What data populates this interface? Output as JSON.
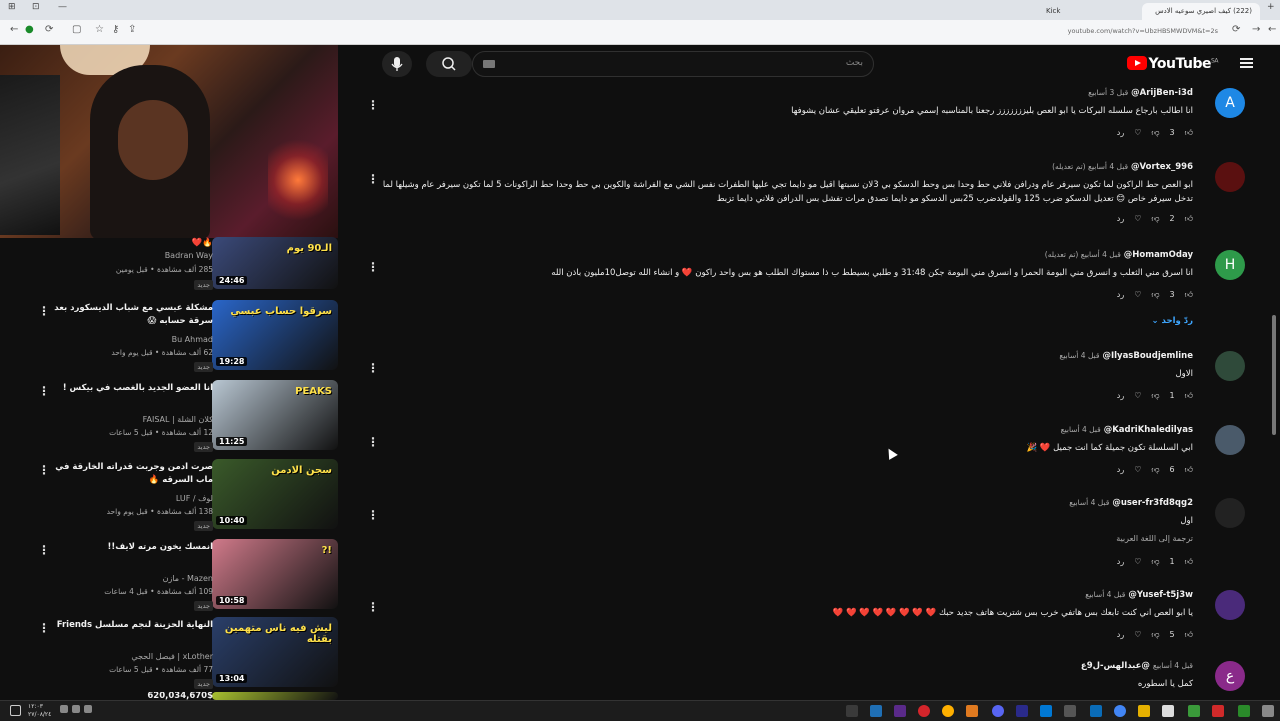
{
  "browser": {
    "tabs": [
      {
        "label": "(222) كيف اصيري سوعيه الادس",
        "active": true
      },
      {
        "label": "Kick",
        "active": false
      }
    ],
    "url": "youtube.com/watch?v=UbzHBSMWDVM&t=2s"
  },
  "youtube": {
    "logo": "YouTube",
    "region": "SA",
    "search_placeholder": "بحث"
  },
  "sidebar": {
    "videos": [
      {
        "title": "🔥❤️",
        "channel": "Badran Way",
        "meta": "285 ألف مشاهدة • قبل يومين",
        "badge": "جديد",
        "duration": "24:46",
        "thumb_text": "الـ90 يوم",
        "thumb_color": "#3b4a7a"
      },
      {
        "title": "مشكلة عبسي مع شباب الديسكورد بعد سرقة حسابه 😱",
        "channel": "Bu Ahmad",
        "meta": "62 ألف مشاهدة • قبل يوم واحد",
        "badge": "جديد",
        "duration": "19:28",
        "thumb_text": "سرقوا حساب عبسي",
        "thumb_color": "#2a66c9"
      },
      {
        "title": "انا العضو الجديد بالغصب في بيكس !",
        "channel": "كلان الشلة | FAISAL",
        "meta": "12 ألف مشاهدة • قبل 5 ساعات",
        "badge": "جديد",
        "duration": "11:25",
        "thumb_text": "PEAKS",
        "thumb_color": "#b9c7d3"
      },
      {
        "title": "صرت ادمن وجربت قدراته الخارقة في ماب السرقه 🔥",
        "channel": "لوف / LUF",
        "meta": "138 ألف مشاهدة • قبل يوم واحد",
        "badge": "جديد",
        "duration": "10:40",
        "thumb_text": "سجن الادمن",
        "thumb_color": "#3a5a2a"
      },
      {
        "title": "انمسك يخون مرته لايف!!",
        "channel": "Mazen - مازن",
        "meta": "109 ألف مشاهدة • قبل 4 ساعات",
        "badge": "جديد",
        "duration": "10:58",
        "thumb_text": "!?",
        "thumb_color": "#d07a8a"
      },
      {
        "title": "النهاية الحزينة لنجم مسلسل Friends",
        "channel": "xLother | فيصل الحجي",
        "meta": "77 ألف مشاهدة • قبل 5 ساعات",
        "badge": "جديد",
        "duration": "13:04",
        "thumb_text": "ليش فيه ناس متهمين بقتله",
        "thumb_color": "#2a3f6a"
      },
      {
        "title": "620,034,670$",
        "channel": "",
        "meta": "",
        "badge": "",
        "duration": "",
        "thumb_text": "",
        "thumb_color": "#a8c030"
      }
    ]
  },
  "comments": [
    {
      "author": "@ArijBen-i3d",
      "time": "قبل 3 أسابيع",
      "avatar": "A",
      "avatar_color": "#1e88e5",
      "text": "انا اطالب  بارجاع سلسله البركات يا ابو العص بليززززززز رجعنا بالمناسبه إسمي مروان عرفتو تعليقي عشان يشوفها",
      "likes": "3",
      "reply": "رد"
    },
    {
      "author": "@Vortex_996",
      "time": "قبل 4 أسابيع (تم تعديله)",
      "avatar": "",
      "avatar_color": "#5a1010",
      "text": "ابو العص حط الراكون لما تكون سيرفر  عام ودرافن فلاني حط وحدا بس وحط الدسكو بي 3لان نسبتها اقيل مو دايما تجي عليها الطفرات نفس الشي  مع الفراشة والكوين بي حط وحدا حط الراكونات 5 لما تكون سيرفر عام وشيلها لما تدخل سيرفر خاص 😊 تعديل الدسكو ضرب 125 والقولدضرب 25بس الدسكو مو دايما تصدق مرات تفشل بس الدرافن فلاني دايما تزبط",
      "likes": "2",
      "reply": "رد"
    },
    {
      "author": "@HomamOday",
      "time": "قبل 4 أسابيع (تم تعديله)",
      "avatar": "H",
      "avatar_color": "#2e9a4a",
      "text": "انا اسرق مني الثعلب و انسرق مني البومة الحمرا و انسرق مني البومة جكن  31:48  و طلبي بسيطط ب ذا مستواك الطلب هو بس واحد راكون ❤️ و انشاء الله توصل10مليون باذن الله",
      "likes": "3",
      "reply": "رد",
      "replies": "ردّ واحد"
    },
    {
      "author": "@IlyasBoudjemline",
      "time": "قبل 4 أسابيع",
      "avatar": "",
      "avatar_color": "#2f4a3a",
      "text": "الاول",
      "likes": "1",
      "reply": "رد"
    },
    {
      "author": "@KadriKhaledilyas",
      "time": "قبل 4 أسابيع",
      "avatar": "",
      "avatar_color": "#4a5a6a",
      "text": "ابي السلسلة تكون جميلة كما انت جميل ❤️ 🎉",
      "likes": "6",
      "reply": "رد"
    },
    {
      "author": "@user-fr3fd8qg2",
      "time": "قبل 4 أسابيع",
      "avatar": "",
      "avatar_color": "#222222",
      "text": "اول",
      "translate": "ترجمة إلى اللغة العربية",
      "likes": "1",
      "reply": "رد"
    },
    {
      "author": "@Yusef-t5j3w",
      "time": "قبل 4 أسابيع",
      "avatar": "",
      "avatar_color": "#4a2a7a",
      "text": "يا ابو العص اني كنت تابعك بس هاتفي خرب بس شتريت هاتف جديد حبك ❤️ ❤️ ❤️ ❤️ ❤️ ❤️ ❤️ ❤️",
      "likes": "5",
      "reply": "رد"
    },
    {
      "author": "@عبدالهس-ل9ع",
      "time": "قبل 4 أسابيع",
      "avatar": "ع",
      "avatar_color": "#8a2a8a",
      "text": "كمل يا اسطوره",
      "likes": "",
      "reply": ""
    }
  ],
  "taskbar": {
    "time": "١٢:٠٣",
    "date": "٢٧/٠٨/٢٤"
  }
}
